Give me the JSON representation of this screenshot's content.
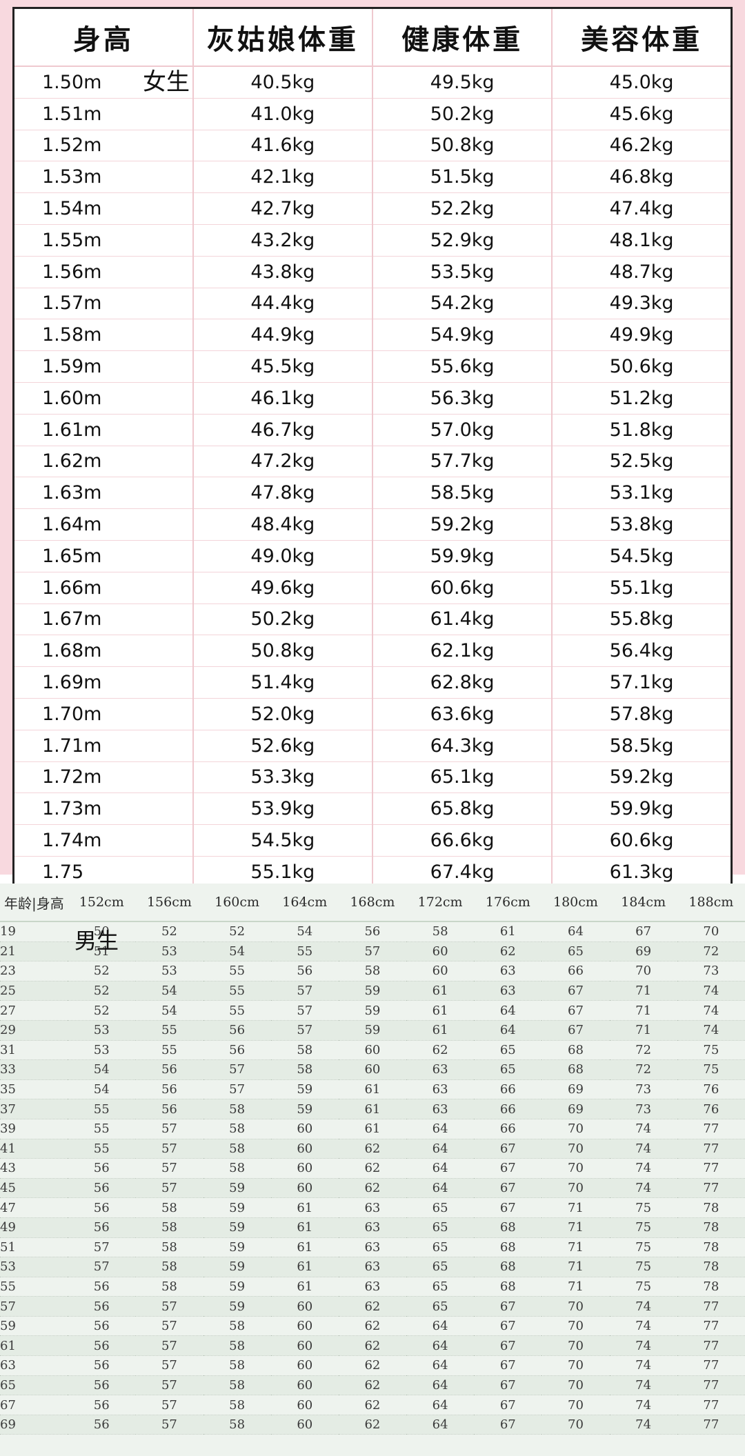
{
  "female": {
    "tag": "女生",
    "headers": [
      "身高",
      "灰姑娘体重",
      "健康体重",
      "美容体重"
    ],
    "rows": [
      [
        "1.50m",
        "40.5kg",
        "49.5kg",
        "45.0kg"
      ],
      [
        "1.51m",
        "41.0kg",
        "50.2kg",
        "45.6kg"
      ],
      [
        "1.52m",
        "41.6kg",
        "50.8kg",
        "46.2kg"
      ],
      [
        "1.53m",
        "42.1kg",
        "51.5kg",
        "46.8kg"
      ],
      [
        "1.54m",
        "42.7kg",
        "52.2kg",
        "47.4kg"
      ],
      [
        "1.55m",
        "43.2kg",
        "52.9kg",
        "48.1kg"
      ],
      [
        "1.56m",
        "43.8kg",
        "53.5kg",
        "48.7kg"
      ],
      [
        "1.57m",
        "44.4kg",
        "54.2kg",
        "49.3kg"
      ],
      [
        "1.58m",
        "44.9kg",
        "54.9kg",
        "49.9kg"
      ],
      [
        "1.59m",
        "45.5kg",
        "55.6kg",
        "50.6kg"
      ],
      [
        "1.60m",
        "46.1kg",
        "56.3kg",
        "51.2kg"
      ],
      [
        "1.61m",
        "46.7kg",
        "57.0kg",
        "51.8kg"
      ],
      [
        "1.62m",
        "47.2kg",
        "57.7kg",
        "52.5kg"
      ],
      [
        "1.63m",
        "47.8kg",
        "58.5kg",
        "53.1kg"
      ],
      [
        "1.64m",
        "48.4kg",
        "59.2kg",
        "53.8kg"
      ],
      [
        "1.65m",
        "49.0kg",
        "59.9kg",
        "54.5kg"
      ],
      [
        "1.66m",
        "49.6kg",
        "60.6kg",
        "55.1kg"
      ],
      [
        "1.67m",
        "50.2kg",
        "61.4kg",
        "55.8kg"
      ],
      [
        "1.68m",
        "50.8kg",
        "62.1kg",
        "56.4kg"
      ],
      [
        "1.69m",
        "51.4kg",
        "62.8kg",
        "57.1kg"
      ],
      [
        "1.70m",
        "52.0kg",
        "63.6kg",
        "57.8kg"
      ],
      [
        "1.71m",
        "52.6kg",
        "64.3kg",
        "58.5kg"
      ],
      [
        "1.72m",
        "53.3kg",
        "65.1kg",
        "59.2kg"
      ],
      [
        "1.73m",
        "53.9kg",
        "65.8kg",
        "59.9kg"
      ],
      [
        "1.74m",
        "54.5kg",
        "66.6kg",
        "60.6kg"
      ],
      [
        "1.75",
        "55.1kg",
        "67.4kg",
        "61.3kg"
      ]
    ]
  },
  "male": {
    "tag": "男生",
    "headers": [
      "年龄|身高",
      "152cm",
      "156cm",
      "160cm",
      "164cm",
      "168cm",
      "172cm",
      "176cm",
      "180cm",
      "184cm",
      "188cm"
    ],
    "rows": [
      [
        "19",
        "50",
        "52",
        "52",
        "54",
        "56",
        "58",
        "61",
        "64",
        "67",
        "70"
      ],
      [
        "21",
        "51",
        "53",
        "54",
        "55",
        "57",
        "60",
        "62",
        "65",
        "69",
        "72"
      ],
      [
        "23",
        "52",
        "53",
        "55",
        "56",
        "58",
        "60",
        "63",
        "66",
        "70",
        "73"
      ],
      [
        "25",
        "52",
        "54",
        "55",
        "57",
        "59",
        "61",
        "63",
        "67",
        "71",
        "74"
      ],
      [
        "27",
        "52",
        "54",
        "55",
        "57",
        "59",
        "61",
        "64",
        "67",
        "71",
        "74"
      ],
      [
        "29",
        "53",
        "55",
        "56",
        "57",
        "59",
        "61",
        "64",
        "67",
        "71",
        "74"
      ],
      [
        "31",
        "53",
        "55",
        "56",
        "58",
        "60",
        "62",
        "65",
        "68",
        "72",
        "75"
      ],
      [
        "33",
        "54",
        "56",
        "57",
        "58",
        "60",
        "63",
        "65",
        "68",
        "72",
        "75"
      ],
      [
        "35",
        "54",
        "56",
        "57",
        "59",
        "61",
        "63",
        "66",
        "69",
        "73",
        "76"
      ],
      [
        "37",
        "55",
        "56",
        "58",
        "59",
        "61",
        "63",
        "66",
        "69",
        "73",
        "76"
      ],
      [
        "39",
        "55",
        "57",
        "58",
        "60",
        "61",
        "64",
        "66",
        "70",
        "74",
        "77"
      ],
      [
        "41",
        "55",
        "57",
        "58",
        "60",
        "62",
        "64",
        "67",
        "70",
        "74",
        "77"
      ],
      [
        "43",
        "56",
        "57",
        "58",
        "60",
        "62",
        "64",
        "67",
        "70",
        "74",
        "77"
      ],
      [
        "45",
        "56",
        "57",
        "59",
        "60",
        "62",
        "64",
        "67",
        "70",
        "74",
        "77"
      ],
      [
        "47",
        "56",
        "58",
        "59",
        "61",
        "63",
        "65",
        "67",
        "71",
        "75",
        "78"
      ],
      [
        "49",
        "56",
        "58",
        "59",
        "61",
        "63",
        "65",
        "68",
        "71",
        "75",
        "78"
      ],
      [
        "51",
        "57",
        "58",
        "59",
        "61",
        "63",
        "65",
        "68",
        "71",
        "75",
        "78"
      ],
      [
        "53",
        "57",
        "58",
        "59",
        "61",
        "63",
        "65",
        "68",
        "71",
        "75",
        "78"
      ],
      [
        "55",
        "56",
        "58",
        "59",
        "61",
        "63",
        "65",
        "68",
        "71",
        "75",
        "78"
      ],
      [
        "57",
        "56",
        "57",
        "59",
        "60",
        "62",
        "65",
        "67",
        "70",
        "74",
        "77"
      ],
      [
        "59",
        "56",
        "57",
        "58",
        "60",
        "62",
        "64",
        "67",
        "70",
        "74",
        "77"
      ],
      [
        "61",
        "56",
        "57",
        "58",
        "60",
        "62",
        "64",
        "67",
        "70",
        "74",
        "77"
      ],
      [
        "63",
        "56",
        "57",
        "58",
        "60",
        "62",
        "64",
        "67",
        "70",
        "74",
        "77"
      ],
      [
        "65",
        "56",
        "57",
        "58",
        "60",
        "62",
        "64",
        "67",
        "70",
        "74",
        "77"
      ],
      [
        "67",
        "56",
        "57",
        "58",
        "60",
        "62",
        "64",
        "67",
        "70",
        "74",
        "77"
      ],
      [
        "69",
        "56",
        "57",
        "58",
        "60",
        "62",
        "64",
        "67",
        "70",
        "74",
        "77"
      ]
    ]
  }
}
